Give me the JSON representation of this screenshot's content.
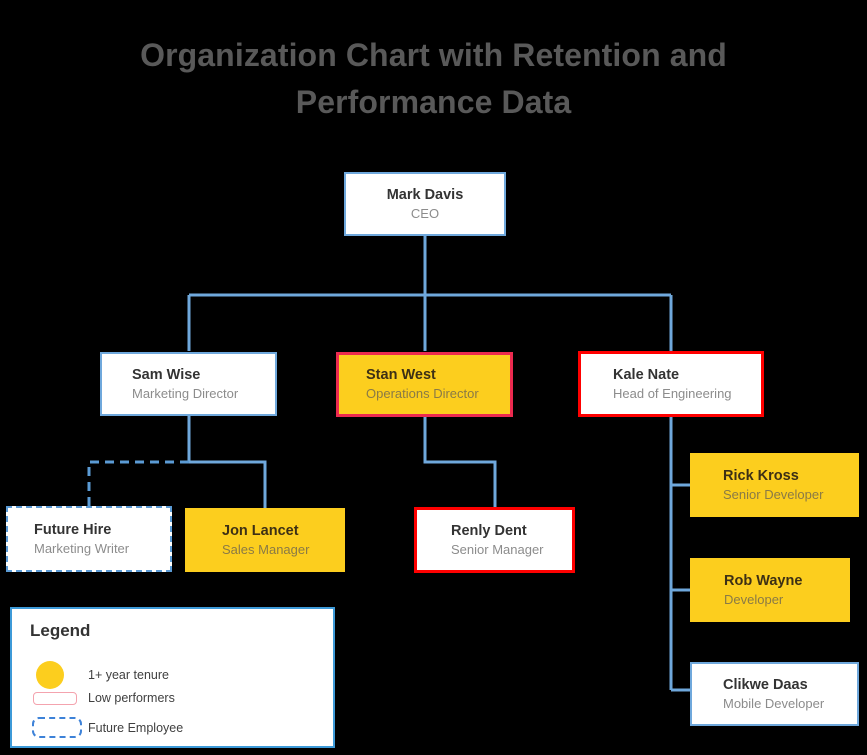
{
  "title": "Organization Chart with Retention and Performance Data",
  "colors": {
    "background": "#000000",
    "title_text": "#595959",
    "connector": "#6FA8DC",
    "node_border_default": "#6FA8DC",
    "node_fill_default": "#FFFFFF",
    "tenure_fill": "#FCCE1E",
    "low_performer_border": "#FF0000",
    "tenure_low_border": "#EC2A4F",
    "future_border": "#5B9BD5",
    "legend_border": "#3D9AD8",
    "name_text": "#333333",
    "title_subtext": "#8C8C8C"
  },
  "nodes": [
    {
      "id": "ceo",
      "name": "Mark Davis",
      "title": "CEO",
      "state": "default",
      "align": "center"
    },
    {
      "id": "sam",
      "name": "Sam Wise",
      "title": "Marketing Director",
      "state": "default",
      "align": "left"
    },
    {
      "id": "stan",
      "name": "Stan West",
      "title": "Operations Director",
      "state": "tenure-low",
      "align": "left"
    },
    {
      "id": "kale",
      "name": "Kale Nate",
      "title": "Head of Engineering",
      "state": "low",
      "align": "left"
    },
    {
      "id": "future",
      "name": "Future Hire",
      "title": "Marketing Writer",
      "state": "future",
      "align": "left"
    },
    {
      "id": "jon",
      "name": "Jon Lancet",
      "title": "Sales Manager",
      "state": "tenure",
      "align": "left"
    },
    {
      "id": "renly",
      "name": "Renly Dent",
      "title": "Senior Manager",
      "state": "low",
      "align": "left"
    },
    {
      "id": "rick",
      "name": "Rick Kross",
      "title": "Senior Developer",
      "state": "tenure",
      "align": "left"
    },
    {
      "id": "rob",
      "name": "Rob Wayne",
      "title": "Developer",
      "state": "tenure",
      "align": "left"
    },
    {
      "id": "clikwe",
      "name": "Clikwe Daas",
      "title": "Mobile Developer",
      "state": "default",
      "align": "left"
    }
  ],
  "legend": {
    "title": "Legend",
    "items": [
      {
        "swatch": "yellow-circle",
        "label": "1+ year tenure"
      },
      {
        "swatch": "red-outline-rect",
        "label": "Low performers"
      },
      {
        "swatch": "blue-dashed-rect",
        "label": "Future Employee"
      }
    ]
  },
  "hierarchy": {
    "Mark Davis": [
      "Sam Wise",
      "Stan West",
      "Kale Nate"
    ],
    "Sam Wise": [
      "Future Hire",
      "Jon Lancet"
    ],
    "Stan West": [
      "Renly Dent"
    ],
    "Kale Nate": [
      "Rick Kross",
      "Rob Wayne",
      "Clikwe Daas"
    ]
  }
}
